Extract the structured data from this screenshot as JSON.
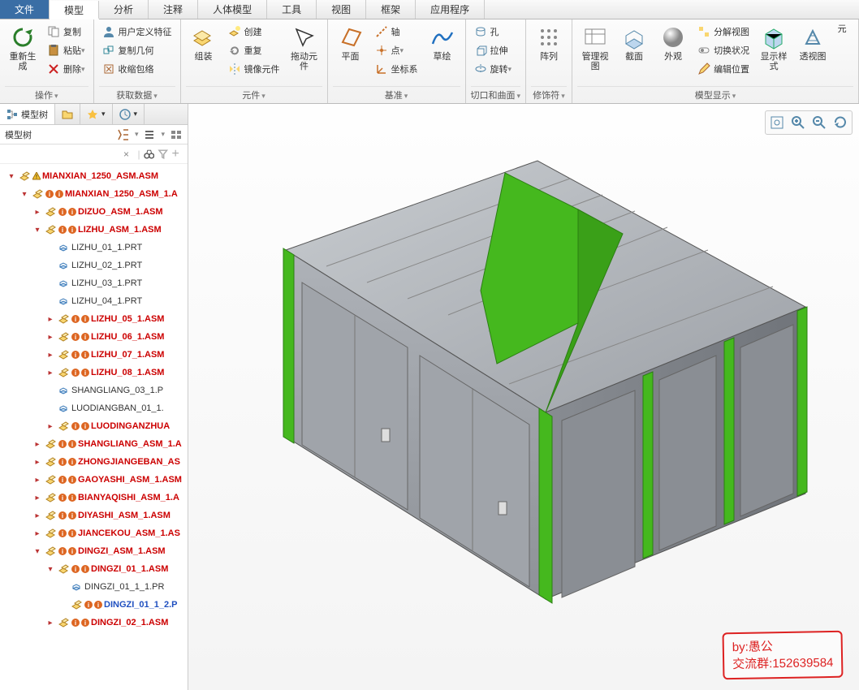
{
  "tabs": [
    "文件",
    "模型",
    "分析",
    "注释",
    "人体模型",
    "工具",
    "视图",
    "框架",
    "应用程序"
  ],
  "activeTab": 1,
  "ribbon": {
    "groups": [
      {
        "title": "操作",
        "items": {
          "regen": "重新生成",
          "copy": "复制",
          "paste": "粘贴",
          "delete": "删除"
        }
      },
      {
        "title": "获取数据",
        "items": {
          "udf": "用户定义特征",
          "copygeo": "复制几何",
          "shrink": "收缩包络"
        }
      },
      {
        "title": "元件",
        "items": {
          "assemble": "组装",
          "create": "创建",
          "redo": "重复",
          "mirror": "镜像元件",
          "drag": "拖动元件"
        }
      },
      {
        "title": "基准",
        "items": {
          "plane": "平面",
          "axis": "轴",
          "point": "点",
          "csys": "坐标系",
          "sketch": "草绘"
        }
      },
      {
        "title": "切口和曲面",
        "items": {
          "hole": "孔",
          "extrude": "拉伸",
          "revolve": "旋转"
        }
      },
      {
        "title": "修饰符",
        "items": {
          "pattern": "阵列"
        }
      },
      {
        "title": "模型显示",
        "items": {
          "mgrview": "管理视图",
          "section": "截面",
          "appear": "外观",
          "explode": "分解视图",
          "switch": "切换状况",
          "editpos": "编辑位置",
          "dispstyle": "显示样式",
          "perspect": "透视图",
          "origin": "元"
        }
      }
    ]
  },
  "side": {
    "tabLabel": "模型树",
    "headerLabel": "模型树"
  },
  "tree": [
    {
      "d": 0,
      "t": "root",
      "exp": "▾",
      "lbl": "MIANXIAN_1250_ASM.ASM",
      "warn": true
    },
    {
      "d": 1,
      "t": "asm",
      "exp": "▾",
      "lbl": "MIANXIAN_1250_ASM_1.A"
    },
    {
      "d": 2,
      "t": "asm",
      "exp": "▸",
      "lbl": "DIZUO_ASM_1.ASM"
    },
    {
      "d": 2,
      "t": "asm",
      "exp": "▾",
      "lbl": "LIZHU_ASM_1.ASM"
    },
    {
      "d": 3,
      "t": "prt",
      "exp": "",
      "lbl": "LIZHU_01_1.PRT"
    },
    {
      "d": 3,
      "t": "prt",
      "exp": "",
      "lbl": "LIZHU_02_1.PRT"
    },
    {
      "d": 3,
      "t": "prt",
      "exp": "",
      "lbl": "LIZHU_03_1.PRT"
    },
    {
      "d": 3,
      "t": "prt",
      "exp": "",
      "lbl": "LIZHU_04_1.PRT"
    },
    {
      "d": 3,
      "t": "asm",
      "exp": "▸",
      "lbl": "LIZHU_05_1.ASM"
    },
    {
      "d": 3,
      "t": "asm",
      "exp": "▸",
      "lbl": "LIZHU_06_1.ASM"
    },
    {
      "d": 3,
      "t": "asm",
      "exp": "▸",
      "lbl": "LIZHU_07_1.ASM"
    },
    {
      "d": 3,
      "t": "asm",
      "exp": "▸",
      "lbl": "LIZHU_08_1.ASM"
    },
    {
      "d": 3,
      "t": "prt",
      "exp": "",
      "lbl": "SHANGLIANG_03_1.P"
    },
    {
      "d": 3,
      "t": "prt",
      "exp": "",
      "lbl": "LUODIANGBAN_01_1."
    },
    {
      "d": 3,
      "t": "asm",
      "exp": "▸",
      "lbl": "LUODINGANZHUA"
    },
    {
      "d": 2,
      "t": "asm",
      "exp": "▸",
      "lbl": "SHANGLIANG_ASM_1.A"
    },
    {
      "d": 2,
      "t": "asm",
      "exp": "▸",
      "lbl": "ZHONGJIANGEBAN_AS"
    },
    {
      "d": 2,
      "t": "asm",
      "exp": "▸",
      "lbl": "GAOYASHI_ASM_1.ASM"
    },
    {
      "d": 2,
      "t": "asm",
      "exp": "▸",
      "lbl": "BIANYAQISHI_ASM_1.A"
    },
    {
      "d": 2,
      "t": "asm",
      "exp": "▸",
      "lbl": "DIYASHI_ASM_1.ASM"
    },
    {
      "d": 2,
      "t": "asm",
      "exp": "▸",
      "lbl": "JIANCEKOU_ASM_1.AS"
    },
    {
      "d": 2,
      "t": "asm",
      "exp": "▾",
      "lbl": "DINGZI_ASM_1.ASM"
    },
    {
      "d": 3,
      "t": "asm",
      "exp": "▾",
      "lbl": "DINGZI_01_1.ASM"
    },
    {
      "d": 4,
      "t": "prt",
      "exp": "",
      "lbl": "DINGZI_01_1_1.PR"
    },
    {
      "d": 4,
      "t": "asm-blue",
      "exp": "",
      "lbl": "DINGZI_01_1_2.P"
    },
    {
      "d": 3,
      "t": "asm",
      "exp": "▸",
      "lbl": "DINGZI_02_1.ASM"
    }
  ],
  "stamp": {
    "line1": "by:愚公",
    "line2": "交流群:152639584"
  }
}
